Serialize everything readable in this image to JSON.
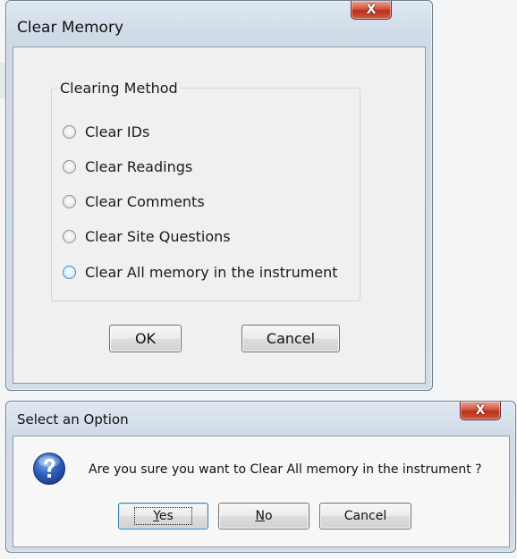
{
  "dialog1": {
    "title": "Clear Memory",
    "close_glyph": "X",
    "group_label": "Clearing Method",
    "options": [
      {
        "label": "Clear IDs",
        "selected": false
      },
      {
        "label": "Clear Readings",
        "selected": false
      },
      {
        "label": "Clear Comments",
        "selected": false
      },
      {
        "label": "Clear Site Questions",
        "selected": false
      },
      {
        "label": "Clear All memory in the instrument",
        "selected": false,
        "hover": true
      }
    ],
    "ok_label": "OK",
    "cancel_label": "Cancel"
  },
  "dialog2": {
    "title": "Select an Option",
    "close_glyph": "X",
    "icon": "question-icon",
    "message": "Are you sure you want to Clear All memory in the instrument ?",
    "yes_mnemonic": "Y",
    "yes_rest": "es",
    "no_mnemonic": "N",
    "no_rest": "o",
    "cancel_label": "Cancel"
  },
  "colors": {
    "close_button": "#c7442c",
    "frame": "#d3dde8",
    "client_bg": "#f0f0f0",
    "radio_hover": "#a9d8f6"
  }
}
